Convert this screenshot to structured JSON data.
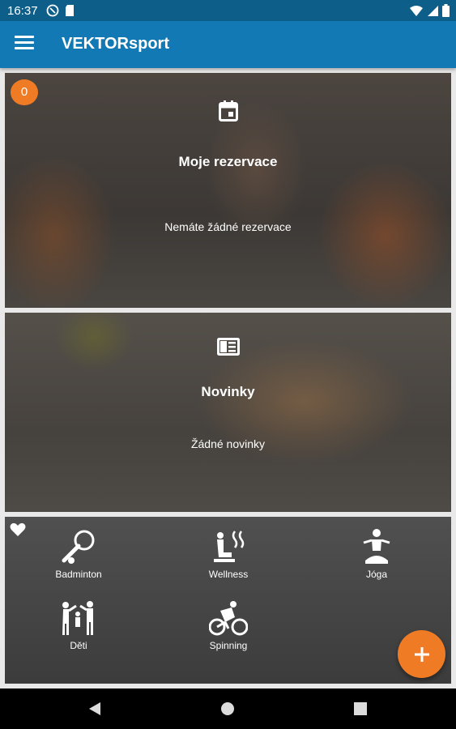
{
  "status_bar": {
    "time": "16:37"
  },
  "app_bar": {
    "title": "VEKTORsport"
  },
  "reservations_card": {
    "badge_count": "0",
    "title": "Moje rezervace",
    "subtitle": "Nemáte žádné rezervace",
    "icon": "calendar-icon"
  },
  "news_card": {
    "title": "Novinky",
    "subtitle": "Žádné novinky",
    "icon": "newspaper-icon"
  },
  "favorites": {
    "icon": "heart-icon",
    "sports": [
      {
        "label": "Badminton",
        "icon": "badminton-icon"
      },
      {
        "label": "Wellness",
        "icon": "wellness-icon"
      },
      {
        "label": "Jóga",
        "icon": "yoga-icon"
      },
      {
        "label": "Děti",
        "icon": "children-icon"
      },
      {
        "label": "Spinning",
        "icon": "cycling-icon"
      }
    ]
  },
  "fab": {
    "icon": "plus-icon"
  },
  "colors": {
    "primary": "#1279b5",
    "status_bar": "#0d5f8a",
    "accent": "#f07b25"
  }
}
